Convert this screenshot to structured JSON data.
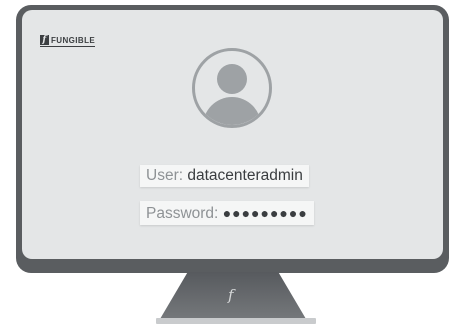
{
  "brand": {
    "logo_mark": "f",
    "logo_text": "FUNGIBLE"
  },
  "login": {
    "user_label": "User:",
    "user_value": "datacenteradmin",
    "password_label": "Password:",
    "password_value": "●●●●●●●●●"
  },
  "stand": {
    "logo_mark": "f"
  },
  "icons": [
    "user-avatar-icon",
    "fungible-logo-icon"
  ],
  "colors": {
    "bezel": "#5a5d60",
    "screen": "#e4e6e7",
    "avatar": "#9ea2a5",
    "field": "#f5f6f6"
  }
}
